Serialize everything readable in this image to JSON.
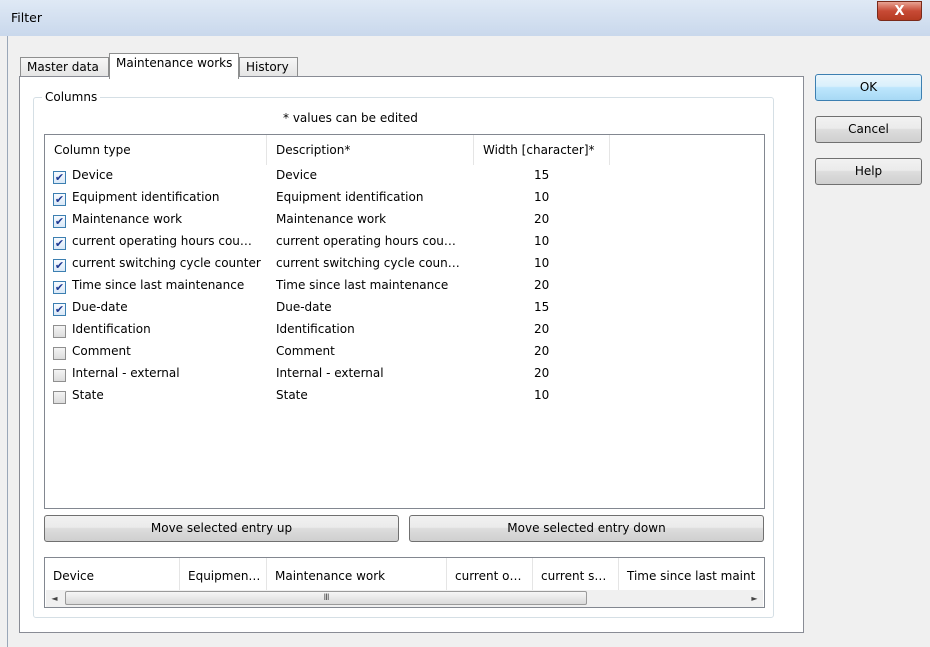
{
  "window": {
    "title": "Filter",
    "close_glyph": "X"
  },
  "tabs": [
    {
      "label": "Master data"
    },
    {
      "label": "Maintenance works",
      "active": true
    },
    {
      "label": "History"
    }
  ],
  "group": {
    "label": "Columns",
    "hint": "* values can be edited"
  },
  "columns_list": {
    "headers": [
      "Column type",
      "Description*",
      "Width [character]*"
    ],
    "rows": [
      {
        "checked": true,
        "type": "Device",
        "description": "Device",
        "width": "15"
      },
      {
        "checked": true,
        "type": "Equipment identification",
        "description": "Equipment identification",
        "width": "10"
      },
      {
        "checked": true,
        "type": "Maintenance work",
        "description": "Maintenance work",
        "width": "20"
      },
      {
        "checked": true,
        "type": "current operating hours cou…",
        "description": "current operating hours cou…",
        "width": "10"
      },
      {
        "checked": true,
        "type": "current switching cycle counter",
        "description": "current switching cycle coun…",
        "width": "10"
      },
      {
        "checked": true,
        "type": "Time since last maintenance",
        "description": "Time since last maintenance",
        "width": "20"
      },
      {
        "checked": true,
        "type": "Due-date",
        "description": "Due-date",
        "width": "15"
      },
      {
        "checked": false,
        "type": "Identification",
        "description": "Identification",
        "width": "20"
      },
      {
        "checked": false,
        "type": "Comment",
        "description": "Comment",
        "width": "20"
      },
      {
        "checked": false,
        "type": "Internal - external",
        "description": "Internal - external",
        "width": "20"
      },
      {
        "checked": false,
        "type": "State",
        "description": "State",
        "width": "10"
      }
    ]
  },
  "buttons": {
    "move_up": "Move selected entry up",
    "move_down": "Move selected entry down",
    "ok": "OK",
    "cancel": "Cancel",
    "help": "Help"
  },
  "preview": {
    "headers": [
      "Device",
      "Equipmen…",
      "Maintenance work",
      "current o…",
      "current s…",
      "Time since last maint"
    ],
    "scroll_left_icon": "◄",
    "scroll_right_icon": "►",
    "thumb_grip": "III"
  },
  "icons": {
    "checkbox_check": "✔"
  }
}
